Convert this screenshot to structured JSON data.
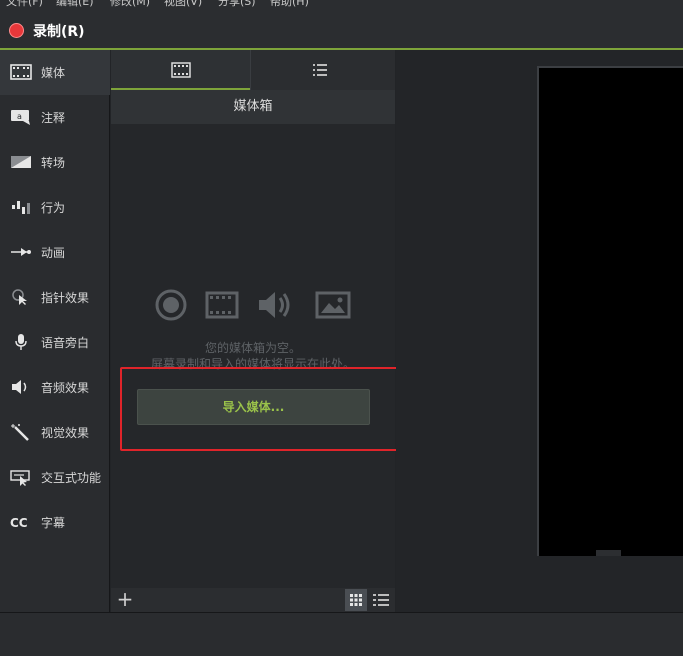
{
  "menubar": {
    "items": [
      "文件(F)",
      "编辑(E)",
      "修改(M)",
      "视图(V)",
      "分享(S)",
      "帮助(H)"
    ]
  },
  "record": {
    "label": "录制(R)",
    "dot_color": "#e8373a"
  },
  "leftnav": {
    "items": [
      {
        "id": "media",
        "label": "媒体",
        "icon": "film-icon",
        "active": true
      },
      {
        "id": "annotations",
        "label": "注释",
        "icon": "callout-icon",
        "active": false
      },
      {
        "id": "transitions",
        "label": "转场",
        "icon": "transition-icon",
        "active": false
      },
      {
        "id": "behaviors",
        "label": "行为",
        "icon": "behavior-icon",
        "active": false
      },
      {
        "id": "animations",
        "label": "动画",
        "icon": "animation-arrow-icon",
        "active": false
      },
      {
        "id": "cursor-effects",
        "label": "指针效果",
        "icon": "cursor-effect-icon",
        "active": false
      },
      {
        "id": "voice-narration",
        "label": "语音旁白",
        "icon": "microphone-icon",
        "active": false
      },
      {
        "id": "audio-effects",
        "label": "音频效果",
        "icon": "speaker-icon",
        "active": false
      },
      {
        "id": "visual-effects",
        "label": "视觉效果",
        "icon": "magic-wand-icon",
        "active": false
      },
      {
        "id": "interactivity",
        "label": "交互式功能",
        "icon": "interactive-icon",
        "active": false
      },
      {
        "id": "captions",
        "label": "字幕",
        "icon": "cc-icon",
        "active": false
      }
    ]
  },
  "bin": {
    "title": "媒体箱",
    "tabs": [
      {
        "icon": "film-strip-icon",
        "active": true
      },
      {
        "icon": "list-icon",
        "active": false
      }
    ],
    "empty_line1": "您的媒体箱为空。",
    "empty_line2": "屏幕录制和导入的媒体将显示在此处。",
    "import_label": "导入媒体...",
    "add_label": "+"
  },
  "colors": {
    "accent": "#7ea43a",
    "import_text": "#9ac24a",
    "highlight": "#e0242a"
  }
}
